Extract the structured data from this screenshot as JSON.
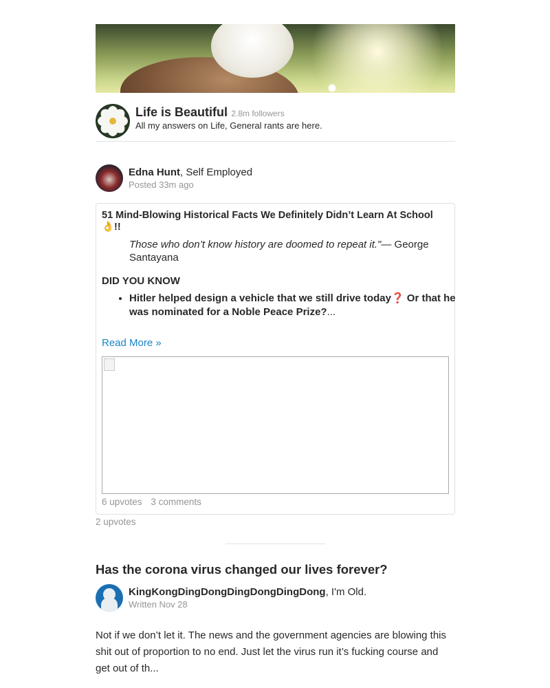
{
  "space": {
    "name": "Life is Beautiful",
    "followers": "· 2.8m followers",
    "description": "All my answers on Life, General rants are here."
  },
  "post": {
    "author_name": "Edna Hunt",
    "author_credential": ", Self Employed",
    "posted": "Posted 33m ago",
    "shared": {
      "title": "51 Mind-Blowing Historical Facts We Definitely Didn’t Learn At School 👌!!",
      "quote_text": "Those who don’t know history are doomed to repeat it.\"",
      "quote_author": "— George Santayana",
      "section_heading": "DID YOU KNOW",
      "bullet_part1": "Hitler helped design a vehicle that we still drive today",
      "bullet_mark": "❓",
      "bullet_part2": " Or that he was nominated for a Noble Peace Prize?",
      "bullet_ellipsis": "...",
      "read_more": "Read More »",
      "upvotes": "6 upvotes",
      "comments": "3 comments"
    },
    "upvotes": "2 upvotes"
  },
  "question": {
    "title": "Has the corona virus changed our lives forever?",
    "author_name": "KingKongDingDongDingDongDingDong",
    "author_credential": ", I'm Old.",
    "written": "Written Nov 28",
    "answer": "Not if we don’t let it. The news and the government agencies are blowing this shit out of proportion to no end. Just let the virus run it’s fucking course and get out of th..."
  }
}
